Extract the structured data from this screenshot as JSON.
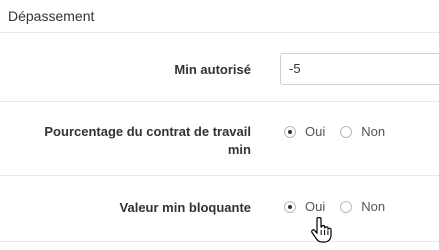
{
  "section": {
    "title": "Dépassement"
  },
  "fields": {
    "min_autorise": {
      "label": "Min autorisé",
      "value": "-5"
    },
    "pourcentage": {
      "label_line1": "Pourcentage du contrat de travail",
      "label_line2": "min",
      "options": [
        "Oui",
        "Non"
      ],
      "selected": "Oui"
    },
    "valeur_min": {
      "label": "Valeur min bloquante",
      "options": [
        "Oui",
        "Non"
      ],
      "selected": "Oui"
    }
  },
  "icons": {
    "cursor": "hand-pointer-icon"
  },
  "colors": {
    "text": "#333333",
    "divider": "#e8e8e8",
    "input_border": "#cfcfcf"
  }
}
